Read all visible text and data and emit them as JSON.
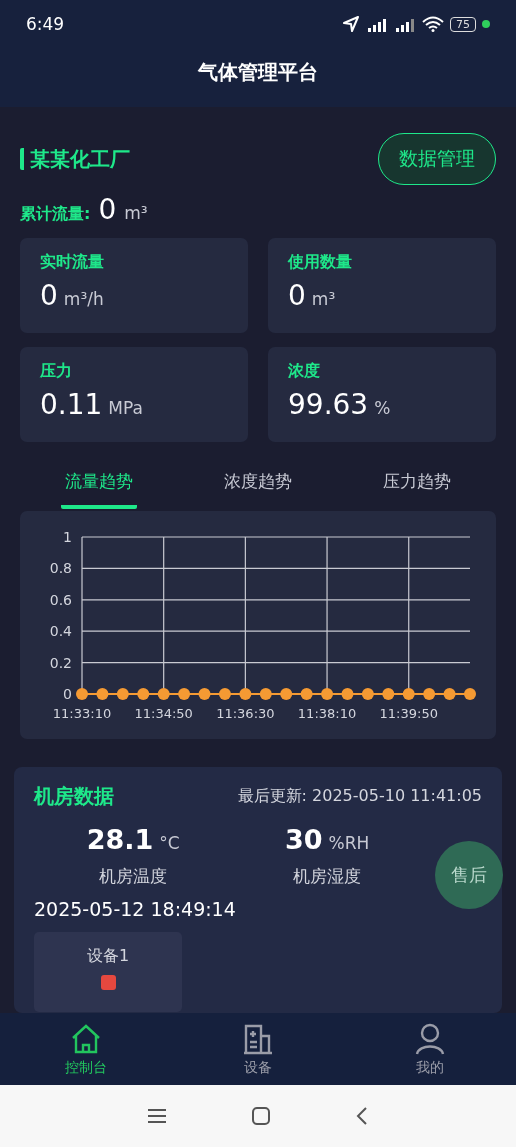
{
  "status_bar": {
    "time": "6:49",
    "battery": "75"
  },
  "header": {
    "title": "气体管理平台"
  },
  "factory": {
    "name": "某某化工厂",
    "button": "数据管理"
  },
  "total_flow": {
    "label": "累计流量:",
    "value": "0",
    "unit": "m³"
  },
  "metrics": [
    {
      "label": "实时流量",
      "value": "0",
      "unit": "m³/h"
    },
    {
      "label": "使用数量",
      "value": "0",
      "unit": "m³"
    },
    {
      "label": "压力",
      "value": "0.11",
      "unit": "MPa"
    },
    {
      "label": "浓度",
      "value": "99.63",
      "unit": "%"
    }
  ],
  "trend_tabs": [
    {
      "label": "流量趋势",
      "selected": true
    },
    {
      "label": "浓度趋势",
      "selected": false
    },
    {
      "label": "压力趋势",
      "selected": false
    }
  ],
  "chart_data": {
    "type": "line",
    "categories": [
      "11:33:10",
      null,
      null,
      null,
      "11:34:50",
      null,
      null,
      null,
      "11:36:30",
      null,
      null,
      null,
      "11:38:10",
      null,
      null,
      null,
      "11:39:50",
      null,
      null,
      null
    ],
    "grid": true,
    "series": [
      {
        "color": "#f59a33",
        "marker": "circle",
        "values": [
          0,
          0,
          0,
          0,
          0,
          0,
          0,
          0,
          0,
          0,
          0,
          0,
          0,
          0,
          0,
          0,
          0,
          0,
          0,
          0
        ]
      }
    ],
    "ylim": [
      0,
      1
    ],
    "yticks": [
      0,
      0.2,
      0.4,
      0.6,
      0.8,
      1
    ]
  },
  "room": {
    "title": "机房数据",
    "last_update": "最后更新:  2025-05-10 11:41:05",
    "readings": [
      {
        "value": "28.1",
        "unit": "°C",
        "label": "机房温度"
      },
      {
        "value": "30",
        "unit": "%RH",
        "label": "机房湿度"
      }
    ],
    "timestamp": "2025-05-12 18:49:14",
    "devices": [
      {
        "name": "设备1",
        "color": "#e5483f"
      }
    ]
  },
  "after_sales": "售后",
  "bottom_nav": [
    {
      "label": "控制台",
      "kind": "home",
      "selected": true
    },
    {
      "label": "设备",
      "kind": "device",
      "selected": false
    },
    {
      "label": "我的",
      "kind": "user",
      "selected": false
    }
  ]
}
